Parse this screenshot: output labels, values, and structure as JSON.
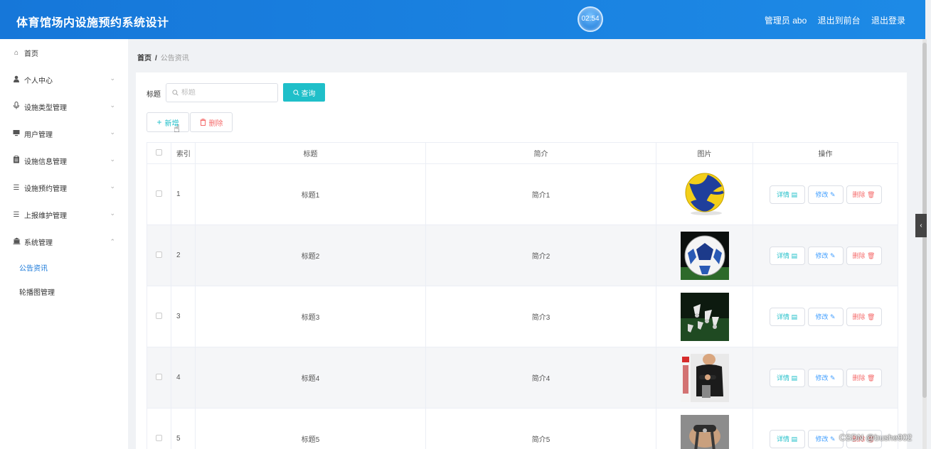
{
  "header": {
    "title": "体育馆场内设施预约系统设计",
    "clock": "02:54",
    "admin": "管理员 abo",
    "back_front": "退出到前台",
    "logout": "退出登录"
  },
  "sidebar": {
    "items": [
      {
        "label": "首页",
        "icon": "home-icon"
      },
      {
        "label": "个人中心",
        "icon": "user-icon"
      },
      {
        "label": "设施类型管理",
        "icon": "microphone-icon"
      },
      {
        "label": "用户管理",
        "icon": "monitor-icon"
      },
      {
        "label": "设施信息管理",
        "icon": "clipboard-icon"
      },
      {
        "label": "设施预约管理",
        "icon": "list-icon"
      },
      {
        "label": "上报维护管理",
        "icon": "list-icon"
      },
      {
        "label": "系统管理",
        "icon": "bank-icon"
      }
    ],
    "sub_items": [
      {
        "label": "公告资讯",
        "active": true
      },
      {
        "label": "轮播图管理",
        "active": false
      }
    ]
  },
  "breadcrumb": {
    "home": "首页",
    "sep": "/",
    "current": "公告资讯"
  },
  "search": {
    "label": "标题",
    "placeholder": "标题",
    "button": "查询"
  },
  "actions": {
    "add": "新增",
    "delete": "删除"
  },
  "table": {
    "headers": {
      "index": "索引",
      "title": "标题",
      "intro": "简介",
      "image": "图片",
      "ops": "操作"
    },
    "op_labels": {
      "detail": "详情",
      "edit": "修改",
      "remove": "删除"
    },
    "rows": [
      {
        "index": "1",
        "title": "标题1",
        "intro": "简介1",
        "image": "volleyball"
      },
      {
        "index": "2",
        "title": "标题2",
        "intro": "简介2",
        "image": "soccer-ball"
      },
      {
        "index": "3",
        "title": "标题3",
        "intro": "简介3",
        "image": "shuttlecocks"
      },
      {
        "index": "4",
        "title": "标题4",
        "intro": "简介4",
        "image": "fitness-person"
      },
      {
        "index": "5",
        "title": "标题5",
        "intro": "简介5",
        "image": "hand-gripper"
      }
    ]
  },
  "watermark": "CSDN @bushe902",
  "colors": {
    "header": "#1677d9",
    "primary": "#1fbfc9",
    "danger": "#f56c6c",
    "edit": "#409eff"
  }
}
